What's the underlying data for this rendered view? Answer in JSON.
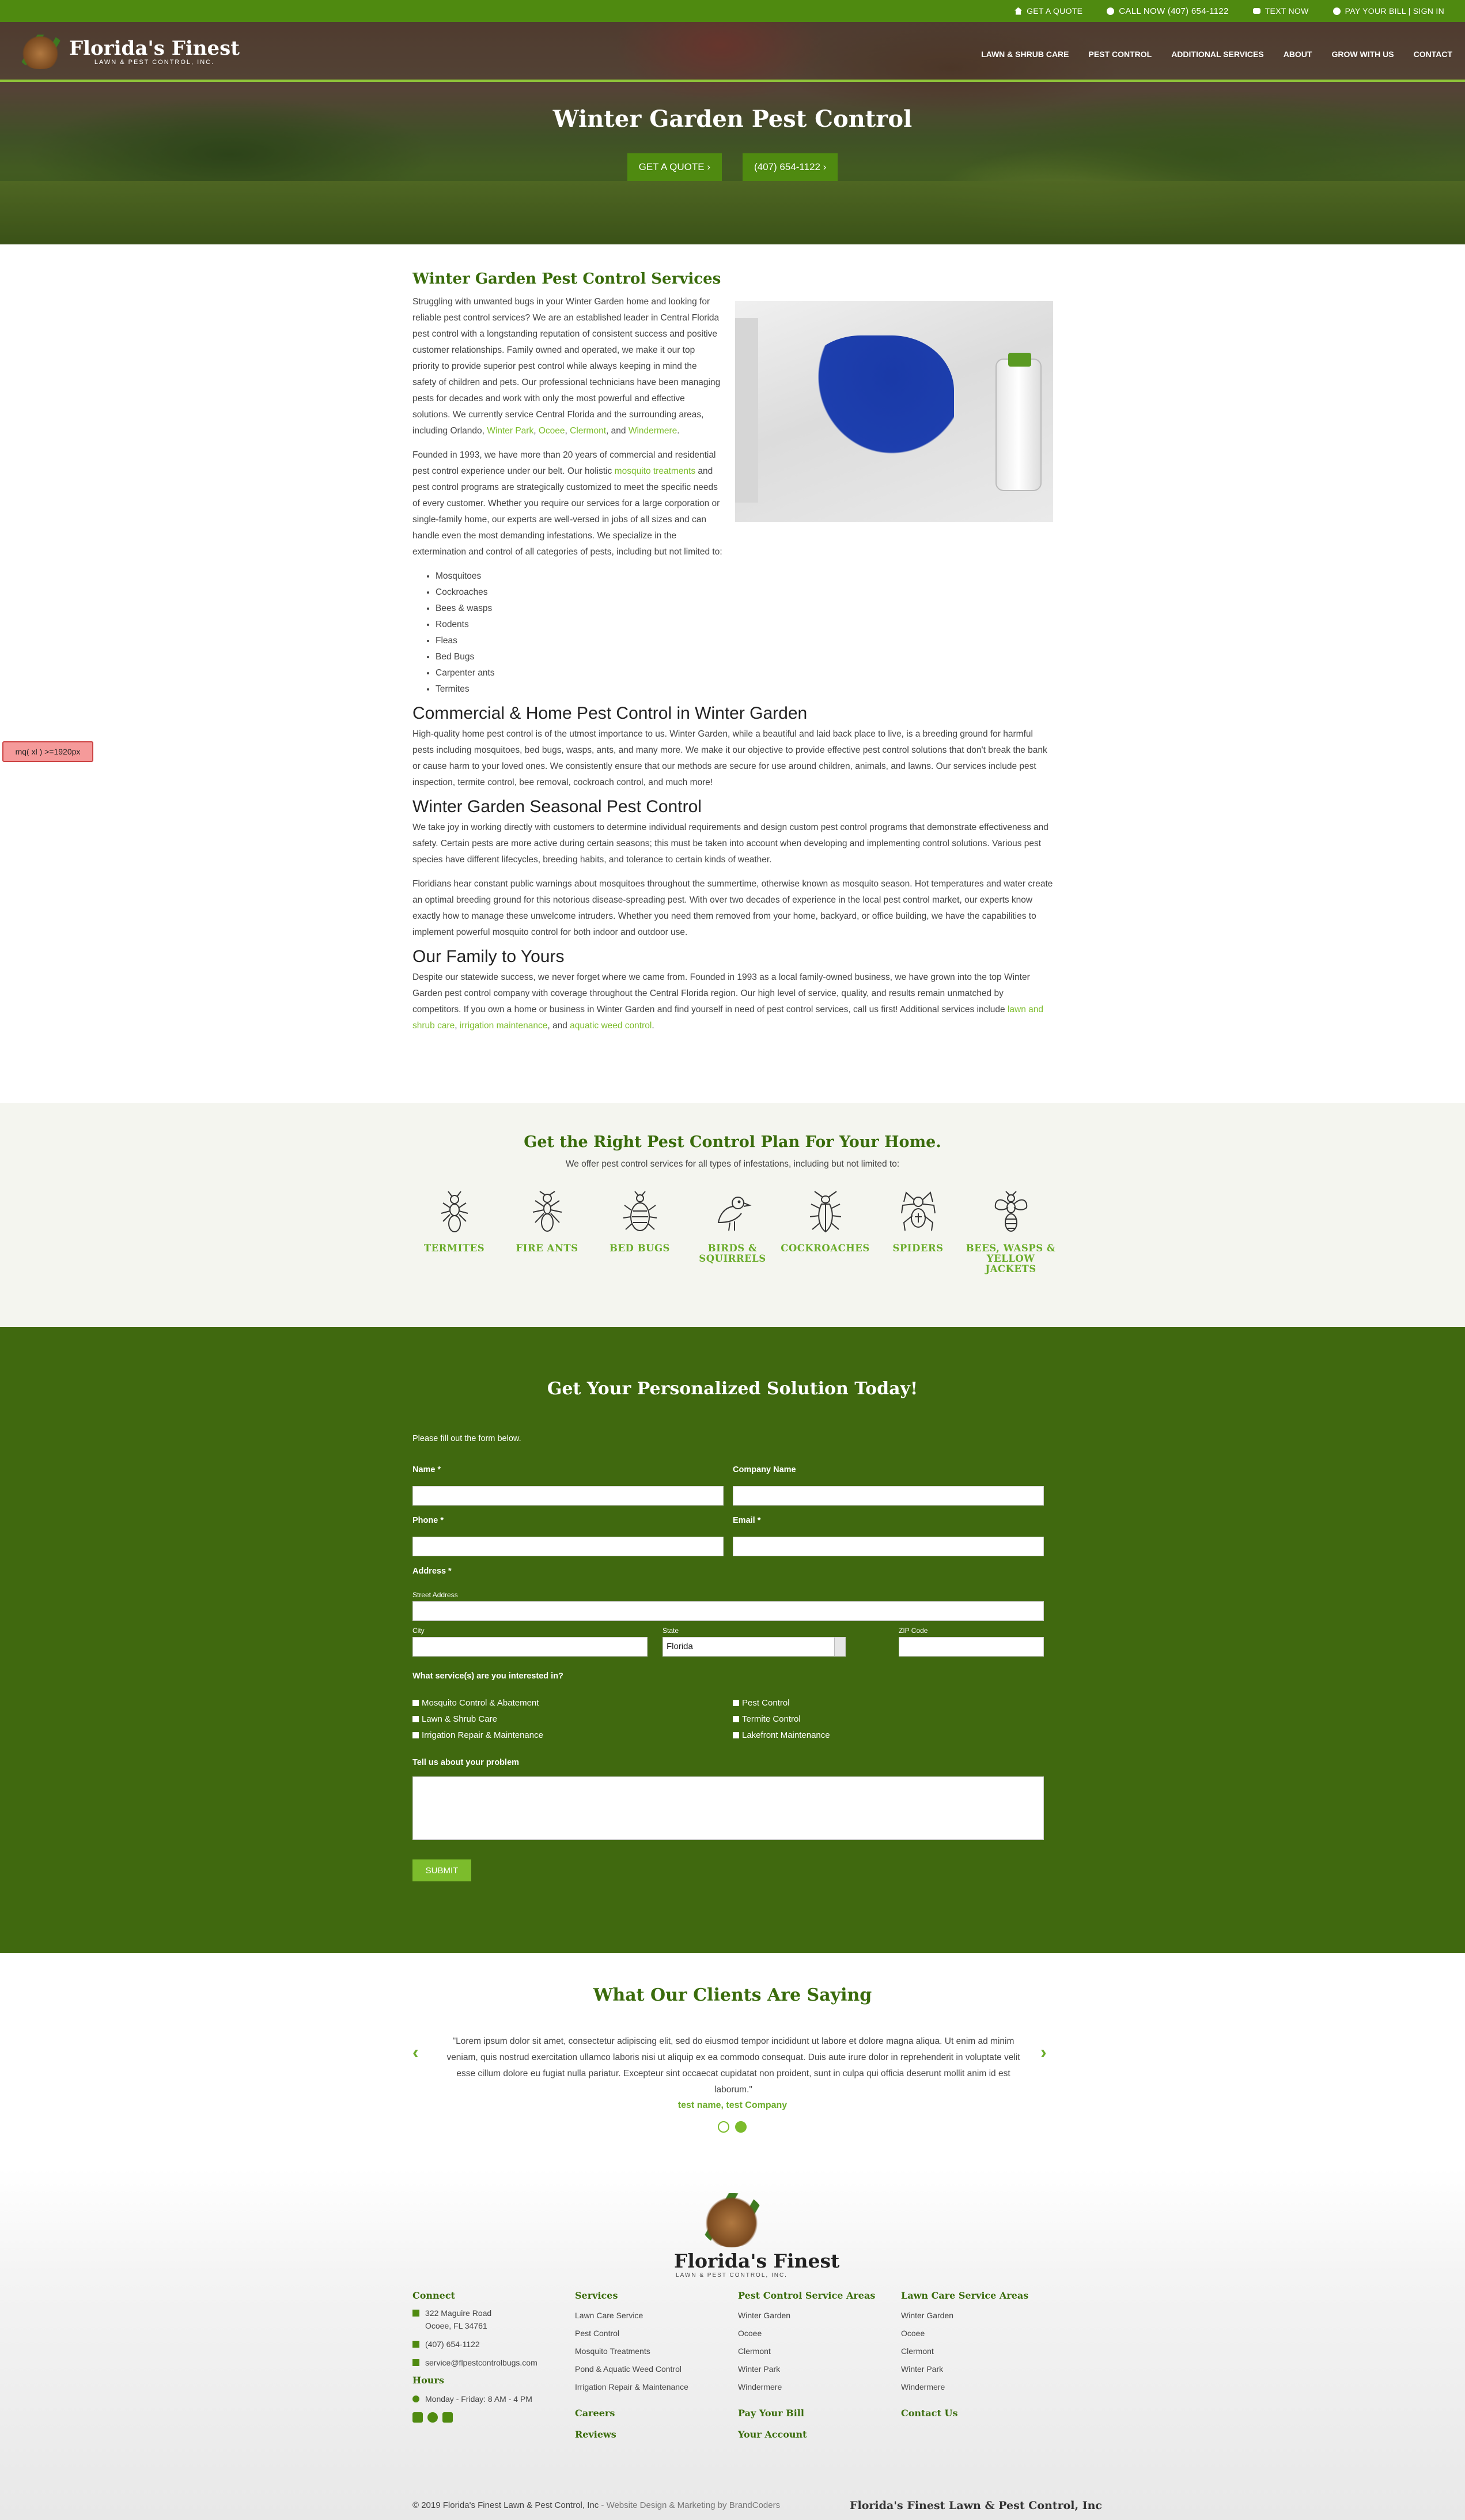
{
  "topbar": {
    "quote": "GET A QUOTE",
    "call": "CALL NOW (407) 654-1122",
    "text": "TEXT NOW",
    "pay": "PAY YOUR BILL | SIGN IN"
  },
  "logo": {
    "name": "Florida's Finest",
    "tagline": "LAWN & PEST CONTROL, INC."
  },
  "nav": [
    "LAWN & SHRUB CARE",
    "PEST CONTROL",
    "ADDITIONAL SERVICES",
    "ABOUT",
    "GROW WITH US",
    "CONTACT"
  ],
  "hero": {
    "title": "Winter Garden Pest Control",
    "btn_quote": "GET A QUOTE",
    "btn_phone": "(407) 654-1122"
  },
  "main": {
    "heading": "Winter Garden Pest Control Services",
    "p1": "Struggling with unwanted bugs in your Winter Garden home and looking for reliable pest control services? We are an established leader in Central Florida pest control with a longstanding reputation of consistent success and positive customer relationships. Family owned and operated, we make it our top priority to provide superior pest control while always keeping in mind the safety of children and pets. Our professional technicians have been managing pests for decades and work with only the most powerful and effective solutions. We currently service Central Florida and the surrounding areas, including Orlando, ",
    "p1_links": [
      "Winter Park",
      "Ocoee",
      "Clermont",
      "Windermere"
    ],
    "p2a": "Founded in 1993, we have more than 20 years of commercial and residential pest control experience under our belt. Our holistic ",
    "p2_link": "mosquito treatments",
    "p2b": " and pest control programs are strategically customized to meet the specific needs of every customer. Whether you require our services for a large corporation or single-family home, our experts are well-versed in jobs of all sizes and can handle even the most demanding infestations. We specialize in the extermination and control of all categories of pests, including but not limited to:",
    "pests": [
      "Mosquitoes",
      "Cockroaches",
      "Bees & wasps",
      "Rodents",
      "Fleas",
      "Bed Bugs",
      "Carpenter ants",
      "Termites"
    ],
    "h_commercial": "Commercial & Home Pest Control in Winter Garden",
    "p_commercial": "High-quality home pest control is of the utmost importance to us. Winter Garden, while a beautiful and laid back place to live, is a breeding ground for harmful pests including mosquitoes, bed bugs, wasps, ants, and many more. We make it our objective to provide effective pest control solutions that don't break the bank or cause harm to your loved ones. We consistently ensure that our methods are secure for use around children, animals, and lawns. Our services include pest inspection, termite control, bee removal, cockroach control, and much more!",
    "h_seasonal": "Winter Garden Seasonal Pest Control",
    "p_seasonal1": "We take joy in working directly with customers to determine individual requirements and design custom pest control programs that demonstrate effectiveness and safety. Certain pests are more active during certain seasons; this must be taken into account when developing and implementing control solutions. Various pest species have different lifecycles, breeding habits, and tolerance to certain kinds of weather.",
    "p_seasonal2": "Floridians hear constant public warnings about mosquitoes throughout the summertime, otherwise known as mosquito season. Hot temperatures and water create an optimal breeding ground for this notorious disease-spreading pest. With over two decades of experience in the local pest control market, our experts know exactly how to manage these unwelcome intruders. Whether you need them removed from your home, backyard, or office building, we have the capabilities to implement powerful mosquito control for both indoor and outdoor use.",
    "h_family": "Our Family to Yours",
    "p_family": "Despite our statewide success, we never forget where we came from. Founded in 1993 as a local family-owned business, we have grown into the top Winter Garden pest control company with coverage throughout the Central Florida region. Our high level of service, quality, and results remain unmatched by competitors. If you own a home or business in Winter Garden and find yourself in need of pest control services, call us first! Additional services include ",
    "p_family_links": [
      "lawn and shrub care",
      "irrigation maintenance",
      "aquatic weed control"
    ]
  },
  "debug_badge": "mq( xl ) >=1920px",
  "plans": {
    "heading": "Get the Right Pest Control Plan For Your Home.",
    "sub": "We offer pest control services for all types of infestations, including but not limited to:",
    "items": [
      {
        "label": "TERMITES",
        "icon": "termite-icon"
      },
      {
        "label": "FIRE ANTS",
        "icon": "ant-icon"
      },
      {
        "label": "BED BUGS",
        "icon": "bedbug-icon"
      },
      {
        "label": "BIRDS & SQUIRRELS",
        "icon": "bird-icon"
      },
      {
        "label": "COCKROACHES",
        "icon": "cockroach-icon"
      },
      {
        "label": "SPIDERS",
        "icon": "spider-icon"
      },
      {
        "label": "BEES, WASPS & YELLOW JACKETS",
        "icon": "bee-icon"
      }
    ]
  },
  "form": {
    "heading": "Get Your Personalized Solution Today!",
    "intro": "Please fill out the form below.",
    "name": "Name *",
    "company": "Company Name",
    "phone": "Phone *",
    "email": "Email *",
    "address": "Address *",
    "street": "Street Address",
    "city": "City",
    "state": "State",
    "state_value": "Florida",
    "zip": "ZIP Code",
    "services_label": "What service(s) are you interested in?",
    "services": [
      "Mosquito Control & Abatement",
      "Lawn & Shrub Care",
      "Irrigation Repair & Maintenance",
      "Pest Control",
      "Termite Control",
      "Lakefront Maintenance"
    ],
    "problem": "Tell us about your problem",
    "submit": "SUBMIT"
  },
  "testimonials": {
    "heading": "What Our Clients Are Saying",
    "quote": "\"Lorem ipsum dolor sit amet, consectetur adipiscing elit, sed do eiusmod tempor incididunt ut labore et dolore magna aliqua. Ut enim ad minim veniam, quis nostrud exercitation ullamco laboris nisi ut aliquip ex ea commodo consequat. Duis aute irure dolor in reprehenderit in voluptate velit esse cillum dolore eu fugiat nulla pariatur. Excepteur sint occaecat cupidatat non proident, sunt in culpa qui officia deserunt mollit anim id est laborum.\"",
    "name": "test name, test Company"
  },
  "footer": {
    "connect": {
      "title": "Connect",
      "address1": "322 Maguire Road",
      "address2": "Ocoee, FL 34761",
      "phone": "(407) 654-1122",
      "email": "service@flpestcontrolbugs.com",
      "hours_title": "Hours",
      "hours": "Monday - Friday: 8 AM - 4 PM"
    },
    "services": {
      "title": "Services",
      "items": [
        "Lawn Care Service",
        "Pest Control",
        "Mosquito Treatments",
        "Pond & Aquatic Weed Control",
        "Irrigation Repair & Maintenance"
      ],
      "links": [
        "Careers",
        "Reviews"
      ]
    },
    "pest_areas": {
      "title": "Pest Control Service Areas",
      "items": [
        "Winter Garden",
        "Ocoee",
        "Clermont",
        "Winter Park",
        "Windermere"
      ],
      "links": [
        "Pay Your Bill",
        "Your Account"
      ]
    },
    "lawn_areas": {
      "title": "Lawn Care Service Areas",
      "items": [
        "Winter Garden",
        "Ocoee",
        "Clermont",
        "Winter Park",
        "Windermere"
      ],
      "links": [
        "Contact Us"
      ]
    },
    "copyright": "© 2019 Florida's Finest Lawn & Pest Control, Inc",
    "credit": " - Website Design & Marketing by BrandCoders",
    "brand": "Florida's Finest Lawn & Pest Control, Inc"
  }
}
